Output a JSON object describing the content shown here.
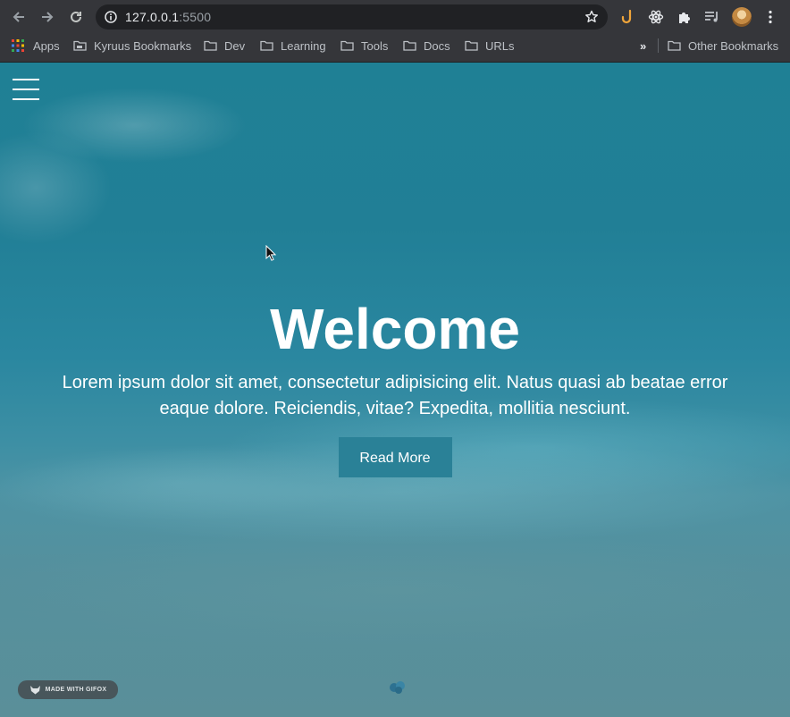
{
  "browser": {
    "url_host": "127.0.0.1",
    "url_port": ":5500",
    "bookmarks": [
      {
        "label": "Apps",
        "icon": "apps-grid-icon"
      },
      {
        "label": "Kyruus Bookmarks",
        "icon": "folder-icon"
      },
      {
        "label": "Dev",
        "icon": "folder-icon"
      },
      {
        "label": "Learning",
        "icon": "folder-icon"
      },
      {
        "label": "Tools",
        "icon": "folder-icon"
      },
      {
        "label": "Docs",
        "icon": "folder-icon"
      },
      {
        "label": "URLs",
        "icon": "folder-icon"
      }
    ],
    "overflow_label": "»",
    "other_bookmarks": "Other Bookmarks"
  },
  "hero": {
    "title": "Welcome",
    "text": "Lorem ipsum dolor sit amet, consectetur adipisicing elit. Natus quasi ab beatae error eaque dolore. Reiciendis, vitae? Expedita, mollitia nesciunt.",
    "button_label": "Read More"
  },
  "watermark": {
    "label": "MADE WITH GIFOX"
  },
  "colors": {
    "chrome": "#35363a",
    "omnibox": "#202124",
    "button": "#2a8197",
    "ocean": "#217f96"
  }
}
